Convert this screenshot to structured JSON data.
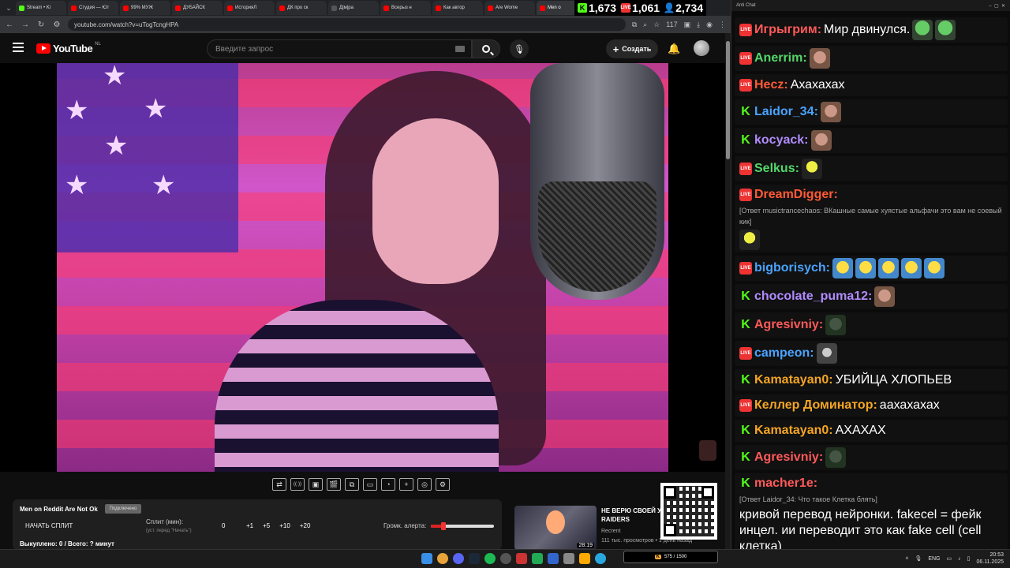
{
  "browser": {
    "tabs": [
      {
        "label": "Stream • Ki",
        "fav": "kick"
      },
      {
        "label": "Студия — Ют",
        "fav": "yt"
      },
      {
        "label": "99% МУЖ",
        "fav": "yt"
      },
      {
        "label": "ДУБАЙСК",
        "fav": "yt"
      },
      {
        "label": "ИсторияЛ",
        "fav": "yt"
      },
      {
        "label": "ДК про ск",
        "fav": "yt"
      },
      {
        "label": "Д|м|ра",
        "fav": "gen"
      },
      {
        "label": "Всерыз н",
        "fav": "yt"
      },
      {
        "label": "Как автор",
        "fav": "yt"
      },
      {
        "label": "Are Wome",
        "fav": "yt"
      },
      {
        "label": "Men о",
        "fav": "yt",
        "active": true
      }
    ],
    "url": "youtube.com/watch?v=uTogTcngHPA",
    "ext_badge": "117"
  },
  "counters": {
    "kick": "1,673",
    "youtube": "1,061",
    "total": "2,734",
    "live_label": "LIVE"
  },
  "youtube": {
    "logo_text": "YouTube",
    "region": "NL",
    "search_placeholder": "Введите запрос",
    "create_label": "Создать"
  },
  "toolbar_icons": [
    "loop-icon",
    "broadcast-icon",
    "screenshot-icon",
    "clapper-icon",
    "picture-in-picture-icon",
    "theater-icon",
    "speed-icon",
    "add-clip-icon",
    "camera-icon",
    "settings-icon"
  ],
  "split_panel": {
    "title": "Men on Reddit Are Not Ok",
    "connected": "Подключено",
    "start_label": "НАЧАТЬ СПЛИТ",
    "split_label": "Сплит (мин):",
    "split_sub": "(уст. перед \"Начать\")",
    "split_value": "0",
    "increments": [
      "+1",
      "+5",
      "+10",
      "+20"
    ],
    "alert_label": "Громк. алерта:",
    "alert_level": 0.2,
    "bought": "Выкуплено: 0 / Всего: ? минут"
  },
  "recommended": {
    "title": "НЕ ВЕРЮ СВОЕЙ У\nRAIDERS",
    "channel": "Recrent",
    "meta": "111 тыс. просмотров • 1 день назад",
    "duration": "28:19"
  },
  "chat": {
    "window_title": "Anti Chat",
    "messages": [
      {
        "plat": "live",
        "user": "Игрыгрим:",
        "color": "#ff5a5a",
        "text": "Мир двинулся.",
        "emotes": [
          "pepe",
          "pepe"
        ]
      },
      {
        "plat": "live",
        "user": "Anerrim:",
        "color": "#53d769",
        "text": "",
        "emotes": [
          "face"
        ]
      },
      {
        "plat": "live",
        "user": "Hecz:",
        "color": "#ff5a36",
        "text": "Ахахахах",
        "emotes": []
      },
      {
        "plat": "kick",
        "user": "Laidor_34:",
        "color": "#4aa3ff",
        "text": "",
        "emotes": [
          "face"
        ]
      },
      {
        "plat": "kick",
        "user": "kocyack:",
        "color": "#b18cff",
        "text": "",
        "emotes": [
          "face"
        ]
      },
      {
        "plat": "live",
        "user": "Selkus:",
        "color": "#53d769",
        "text": "",
        "emotes": [
          "blob"
        ]
      },
      {
        "plat": "live",
        "user": "DreamDigger:",
        "color": "#ff5a36",
        "text": "",
        "emotes": [
          "blob"
        ],
        "reply": "[Ответ musictrancechaos: ВКашные самые хуястые альфачи это вам не соевый кик]"
      },
      {
        "plat": "live",
        "user": "bigborisych:",
        "color": "#4aa3ff",
        "text": "",
        "emotes": [
          "cry",
          "cry",
          "cry",
          "cry",
          "cry"
        ]
      },
      {
        "plat": "kick",
        "user": "chocolate_puma12:",
        "color": "#b18cff",
        "text": "",
        "emotes": [
          "face"
        ]
      },
      {
        "plat": "kick",
        "user": "Agresivniy:",
        "color": "#ff5a5a",
        "text": "",
        "emotes": [
          "seal"
        ]
      },
      {
        "plat": "live",
        "user": "campeon:",
        "color": "#4aa3ff",
        "text": "",
        "emotes": [
          "cat"
        ]
      },
      {
        "plat": "kick",
        "user": "Kamatayan0:",
        "color": "#f5a623",
        "text": "УБИЙЦА ХЛОПЬЕВ",
        "emotes": []
      },
      {
        "plat": "live",
        "user": "Келлер Доминатор:",
        "color": "#f5a623",
        "text": "аахахахах",
        "emotes": []
      },
      {
        "plat": "kick",
        "user": "Kamatayan0:",
        "color": "#f5a623",
        "text": "АХАХАХ",
        "emotes": []
      },
      {
        "plat": "kick",
        "user": "Agresivniy:",
        "color": "#ff5a5a",
        "text": "",
        "emotes": [
          "seal"
        ]
      },
      {
        "plat": "kick",
        "user": "macher1e:",
        "color": "#ff5a5a",
        "text": "",
        "emotes": [],
        "reply": "[Ответ Laidor_34: Что такое Клетка блять]",
        "body": "кривой перевод нейронки. fakecel = фейк инцел. ии переводит это как fake cell (cell клетка)"
      }
    ]
  },
  "taskbar": {
    "lang": "ENG",
    "time": "20:53",
    "date": "06.11.2025",
    "kickbar": "575 / 1500"
  }
}
